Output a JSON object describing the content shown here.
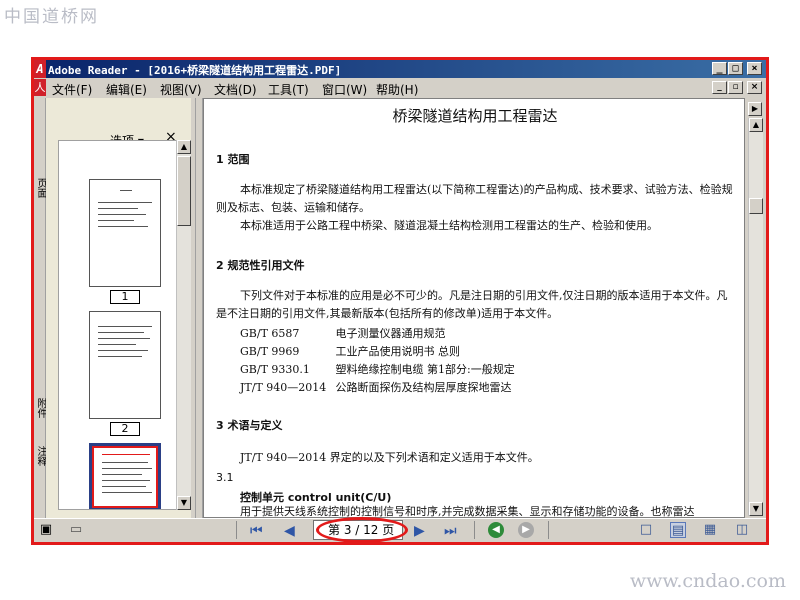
{
  "watermark": {
    "top": "中国道桥网",
    "bottom": "www.cndao.com"
  },
  "window": {
    "title": "Adobe Reader - [2016+桥梁隧道结构用工程雷达.PDF]",
    "controls": {
      "minimize": "_",
      "maximize": "□",
      "close": "×"
    },
    "doc_controls": {
      "minimize": "_",
      "restore": "▫",
      "close": "×"
    }
  },
  "menu": [
    "文件(F)",
    "编辑(E)",
    "视图(V)",
    "文档(D)",
    "工具(T)",
    "窗口(W)",
    "帮助(H)"
  ],
  "side_tabs": {
    "pages": "页面",
    "attachments": "附件",
    "comments": "注释"
  },
  "thumb_pane": {
    "options_label": "选项 ▾",
    "close_label": "×",
    "thumbnails": [
      {
        "number": "1"
      },
      {
        "number": "2"
      },
      {
        "number": ""
      }
    ]
  },
  "document": {
    "title": "桥梁隧道结构用工程雷达",
    "sections": [
      {
        "heading": "1   范围"
      },
      {
        "heading": "2   规范性引用文件"
      },
      {
        "heading": "3   术语与定义"
      }
    ],
    "paragraphs": {
      "scope_1": "本标准规定了桥梁隧道结构用工程雷达(以下简称工程雷达)的产品构成、技术要求、试验方法、检验规则及标志、包装、运输和储存。",
      "scope_2": "本标准适用于公路工程中桥梁、隧道混凝土结构检测用工程雷达的生产、检验和使用。",
      "refs_intro": "下列文件对于本标准的应用是必不可少的。凡是注日期的引用文件,仅注日期的版本适用于本文件。凡是不注日期的引用文件,其最新版本(包括所有的修改单)适用于本文件。",
      "terms_intro": "JT/T 940—2014 界定的以及下列术语和定义适用于本文件。",
      "clause_3_1": "3.1",
      "term_control_unit": "控制单元    control unit(C/U)",
      "term_control_unit_def": "用于提供天线系统控制的控制信号和时序,并完成数据采集、显示和存储功能的设备。也称雷达"
    },
    "references": [
      {
        "code": "GB/T 6587",
        "name": "电子测量仪器通用规范"
      },
      {
        "code": "GB/T 9969",
        "name": "工业产品使用说明书   总则"
      },
      {
        "code": "GB/T 9330.1",
        "name": "塑料绝缘控制电缆   第1部分:一般规定"
      },
      {
        "code": "JT/T 940—2014",
        "name": "公路断面探伤及结构层厚度探地雷达"
      }
    ]
  },
  "navigation": {
    "first": "⏮",
    "prev": "◀",
    "next": "▶",
    "last": "⏭",
    "page_indicator": "第 3 / 12 页",
    "back": "◀",
    "forward": "▶"
  }
}
